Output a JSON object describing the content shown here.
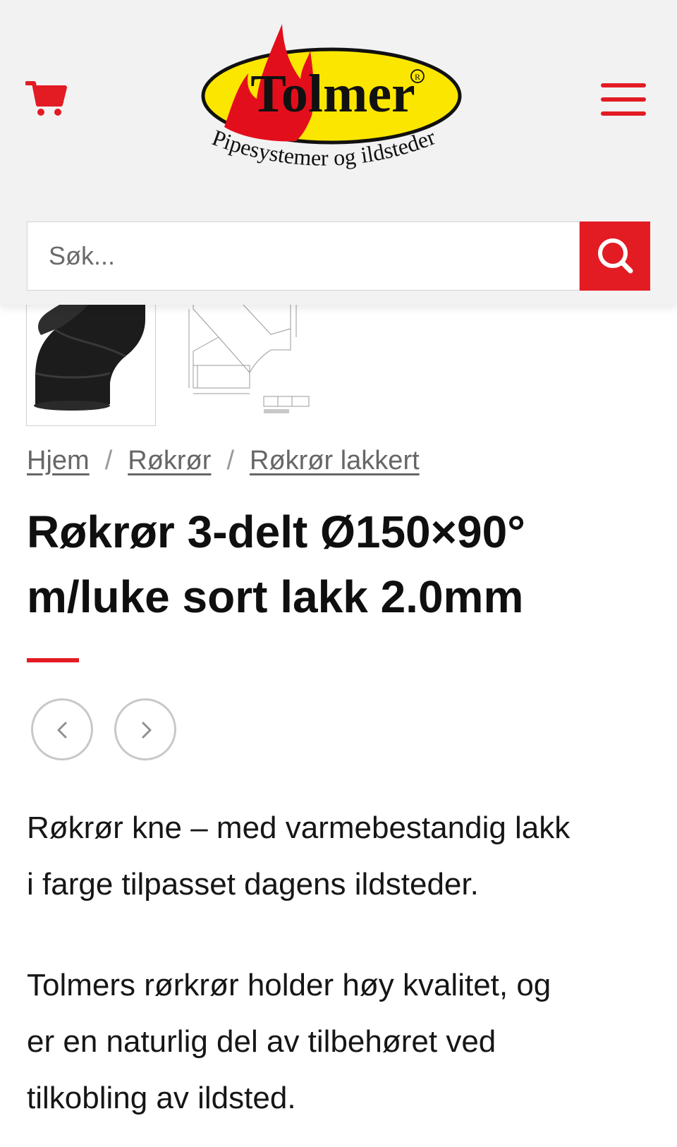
{
  "header": {
    "logo": {
      "brand": "Tolmer",
      "tagline": "Pipesystemer og ildsteder",
      "registered_mark": "R"
    },
    "cart_icon": "cart-icon",
    "menu_icon": "hamburger-menu-icon"
  },
  "search": {
    "placeholder": "Søk...",
    "button_icon": "search-icon"
  },
  "colors": {
    "accent": "#e31b23",
    "logo_yellow": "#fbe600",
    "logo_flame_red": "#e30e1c"
  },
  "gallery": {
    "thumbnails": [
      "product-photo",
      "technical-drawing"
    ]
  },
  "breadcrumb": [
    {
      "label": "Hjem"
    },
    {
      "label": "Røkrør"
    },
    {
      "label": "Røkrør lakkert"
    }
  ],
  "breadcrumb_separator": "/",
  "product": {
    "title_line1": "Røkrør 3-delt Ø150×90°",
    "title_line2": "m/luke sort lakk 2.0mm"
  },
  "nav": {
    "prev_icon": "chevron-left-icon",
    "next_icon": "chevron-right-icon"
  },
  "description": {
    "p1_line1": "Røkrør kne – med varmebestandig lakk",
    "p1_line2": "i farge tilpasset dagens ildsteder.",
    "p2_line1": "Tolmers rørkrør holder høy kvalitet, og",
    "p2_line2": "er en naturlig del av tilbehøret ved",
    "p2_line3": "tilkobling av ildsted."
  }
}
